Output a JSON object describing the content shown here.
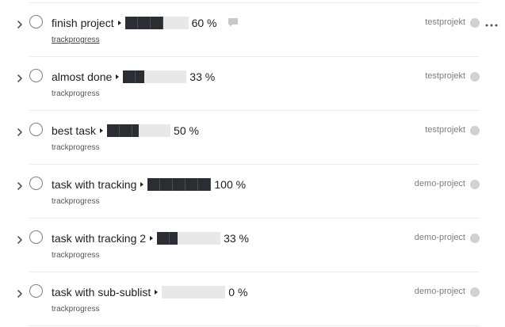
{
  "colors": {
    "progress_fill": "#2a2d31",
    "progress_track": "#e8e8e8",
    "divider": "#ededed",
    "project_dot": "#d2d2d2",
    "text": "#202020",
    "muted": "#7c7c7c"
  },
  "tasks": [
    {
      "name": "finish project",
      "progress": 0.6,
      "percent_label": "60 %",
      "label": "trackprogress",
      "project": "testprojekt",
      "has_comment": true,
      "hovered": true
    },
    {
      "name": "almost done",
      "progress": 0.33,
      "percent_label": "33 %",
      "label": "trackprogress",
      "project": "testprojekt",
      "has_comment": false,
      "hovered": false
    },
    {
      "name": "best task",
      "progress": 0.5,
      "percent_label": "50 %",
      "label": "trackprogress",
      "project": "testprojekt",
      "has_comment": false,
      "hovered": false
    },
    {
      "name": "task with tracking",
      "progress": 1.0,
      "percent_label": "100 %",
      "label": "trackprogress",
      "project": "demo-project",
      "has_comment": false,
      "hovered": false
    },
    {
      "name": "task with tracking 2",
      "progress": 0.33,
      "percent_label": "33 %",
      "label": "trackprogress",
      "project": "demo-project",
      "has_comment": false,
      "hovered": false
    },
    {
      "name": "task with sub-sublist",
      "progress": 0.0,
      "percent_label": "0 %",
      "label": "trackprogress",
      "project": "demo-project",
      "has_comment": false,
      "hovered": false
    }
  ],
  "icons": {
    "expand": "chevron-right-icon",
    "complete": "circle-checkbox-icon",
    "comment": "comment-icon",
    "more": "more-actions-icon",
    "project": "project-dot-icon"
  }
}
